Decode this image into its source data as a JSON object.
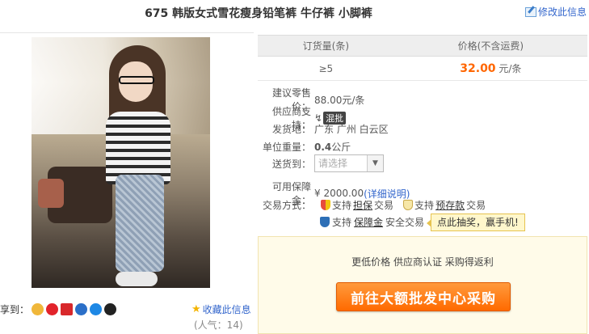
{
  "title": "675 韩版女式雪花瘦身铅笔裤 牛仔裤 小脚裤",
  "edit_link": "修改此信息",
  "price_table": {
    "headers": [
      "订货量(条)",
      "价格(不含运费)"
    ],
    "rows": [
      {
        "qty": "≥5",
        "price": "32.00",
        "unit": "元/条"
      }
    ]
  },
  "details": {
    "retail_label": "建议零售价：",
    "retail_value": "88.00元/条",
    "supply_label": "供应商支持：",
    "supply_tag": "混批",
    "ship_label": "发货地：",
    "ship_value": "广东 广州 白云区",
    "weight_label": "单位重量：",
    "weight_num": "0.4",
    "weight_unit": "公斤",
    "deliver_label": "送货到：",
    "deliver_placeholder": "请选择",
    "guarantee_label": "可用保障金：",
    "guarantee_value": "¥ 2000.00",
    "guarantee_link": "(详细说明)"
  },
  "trade": {
    "label": "交易方式：",
    "escrow_pre": "支持",
    "escrow_u": "担保",
    "escrow_post": "交易",
    "prepay_pre": "支持",
    "prepay_u": "预存款",
    "prepay_post": "交易",
    "deposit_pre": "支持",
    "deposit_u": "保障金",
    "deposit_post": "安全交易",
    "promo": "点此抽奖，赢手机!"
  },
  "cta": {
    "note": "更低价格 供应商认证 采购得返利",
    "button": "前往大额批发中心采购"
  },
  "share": {
    "label": "享到：",
    "fav": "收藏此信息",
    "popularity": "(人气：14)"
  },
  "colors": {
    "accent_orange": "#ff6600",
    "link_blue": "#3366cc",
    "cta_bg": "#fffbe9"
  }
}
